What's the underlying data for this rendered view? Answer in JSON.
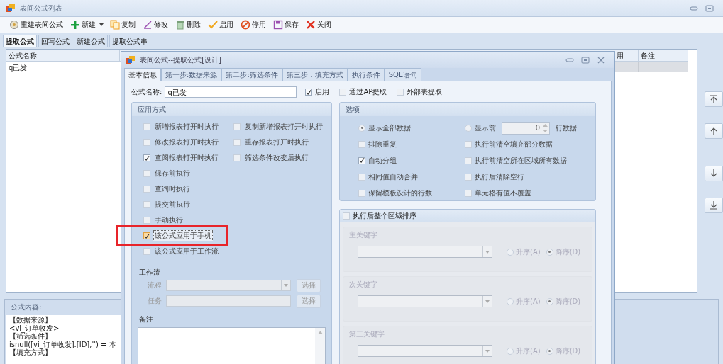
{
  "window": {
    "title": "表间公式列表"
  },
  "toolbar": [
    {
      "kind": "rebuild",
      "label": "重建表间公式",
      "has_menu": false
    },
    {
      "kind": "new",
      "label": "新建",
      "has_menu": true
    },
    {
      "kind": "copy",
      "label": "复制",
      "has_menu": false
    },
    {
      "kind": "edit",
      "label": "修改",
      "has_menu": false
    },
    {
      "kind": "delete",
      "label": "删除",
      "has_menu": false
    },
    {
      "kind": "enable",
      "label": "启用",
      "has_menu": false
    },
    {
      "kind": "disable",
      "label": "停用",
      "has_menu": false
    },
    {
      "kind": "save",
      "label": "保存",
      "has_menu": false
    },
    {
      "kind": "close",
      "label": "关闭",
      "has_menu": false
    }
  ],
  "tabs": [
    {
      "label": "提取公式",
      "selected": true
    },
    {
      "label": "回写公式",
      "selected": false
    },
    {
      "label": "新建公式",
      "selected": false
    },
    {
      "label": "提取公式串",
      "selected": false
    }
  ],
  "table": {
    "columns": [
      "公式名称",
      "用",
      "备注"
    ],
    "rows": [
      {
        "name": "q已发",
        "selected": true
      }
    ]
  },
  "side_buttons": [
    {
      "kind": "top"
    },
    {
      "kind": "up"
    },
    {
      "kind": "down"
    },
    {
      "kind": "bottom"
    }
  ],
  "content_panel": {
    "title": "公式内容:",
    "lines": [
      "【数据来源】",
      "<vi_订单收发>",
      "【筛选条件】",
      "isnull([vi_订单收发].[ID],'') = 本",
      "【填充方式】"
    ]
  },
  "dialog": {
    "title": "表间公式--提取公式[设计]",
    "tabs": [
      {
        "label": "基本信息",
        "selected": true
      },
      {
        "label": "第一步:数据来源",
        "selected": false
      },
      {
        "label": "第二步:筛选条件",
        "selected": false
      },
      {
        "label": "第三步：填充方式",
        "selected": false
      },
      {
        "label": "执行条件",
        "selected": false
      },
      {
        "label": "SQL语句",
        "selected": false
      }
    ],
    "name_label": "公式名称:",
    "name_value": "q已发",
    "flags": [
      {
        "label": "启用",
        "checked": true
      },
      {
        "label": "通过AP提取",
        "checked": false
      },
      {
        "label": "外部表提取",
        "checked": false
      }
    ],
    "apply_group": {
      "title": "应用方式",
      "left": [
        {
          "label": "新增报表打开时执行",
          "checked": false,
          "focused": false,
          "annotated": false
        },
        {
          "label": "修改报表打开时执行",
          "checked": false,
          "focused": false,
          "annotated": false
        },
        {
          "label": "查阅报表打开时执行",
          "checked": true,
          "focused": false,
          "annotated": false
        },
        {
          "label": "保存前执行",
          "checked": false,
          "focused": false,
          "annotated": false
        },
        {
          "label": "查询时执行",
          "checked": false,
          "focused": false,
          "annotated": false
        },
        {
          "label": "提交前执行",
          "checked": false,
          "focused": false,
          "annotated": false
        },
        {
          "label": "手动执行",
          "checked": false,
          "focused": false,
          "annotated": false
        },
        {
          "label": "该公式应用于手机",
          "checked": true,
          "focused": true,
          "annotated": true
        },
        {
          "label": "该公式应用于工作流",
          "checked": false,
          "focused": false,
          "annotated": false
        }
      ],
      "right": [
        {
          "label": "复制新增报表打开时执行",
          "checked": false,
          "focused": false,
          "annotated": false
        },
        {
          "label": "重存报表打开时执行",
          "checked": false,
          "focused": false,
          "annotated": false
        },
        {
          "label": "筛选条件改变后执行",
          "checked": false,
          "focused": false,
          "annotated": false
        }
      ]
    },
    "workflow": {
      "title": "工作流",
      "disabled": true,
      "rows": [
        {
          "label": "流程",
          "kind": "select",
          "button": "选择"
        },
        {
          "label": "任务",
          "kind": "input",
          "button": "选择"
        }
      ]
    },
    "notes": {
      "label": "备注"
    },
    "options_group": {
      "title": "选项",
      "radios": [
        {
          "label": "显示全部数据",
          "selected": true
        },
        {
          "label": "显示前",
          "selected": false
        }
      ],
      "top_value": "0",
      "top_suffix": "行数据",
      "checks": [
        {
          "label": "排除重复",
          "checked": false
        },
        {
          "label": "执行前清空填充部分数据",
          "checked": false
        },
        {
          "label": "自动分组",
          "checked": true
        },
        {
          "label": "执行前清空所在区域所有数据",
          "checked": false
        },
        {
          "label": "相同值自动合并",
          "checked": false
        },
        {
          "label": "执行后清除空行",
          "checked": false
        },
        {
          "label": "保留模板设计的行数",
          "checked": false
        },
        {
          "label": "单元格有值不覆盖",
          "checked": false
        }
      ]
    },
    "sort_group": {
      "title": "执行后整个区域排序",
      "checked": false,
      "keys": [
        {
          "label": "主关键字",
          "asc": "升序(A)",
          "desc": "降序(D)",
          "descending": true
        },
        {
          "label": "次关键字",
          "asc": "升序(A)",
          "desc": "降序(D)",
          "descending": true
        },
        {
          "label": "第三关键字",
          "asc": "升序(A)",
          "desc": "降序(D)",
          "descending": true
        }
      ]
    }
  }
}
